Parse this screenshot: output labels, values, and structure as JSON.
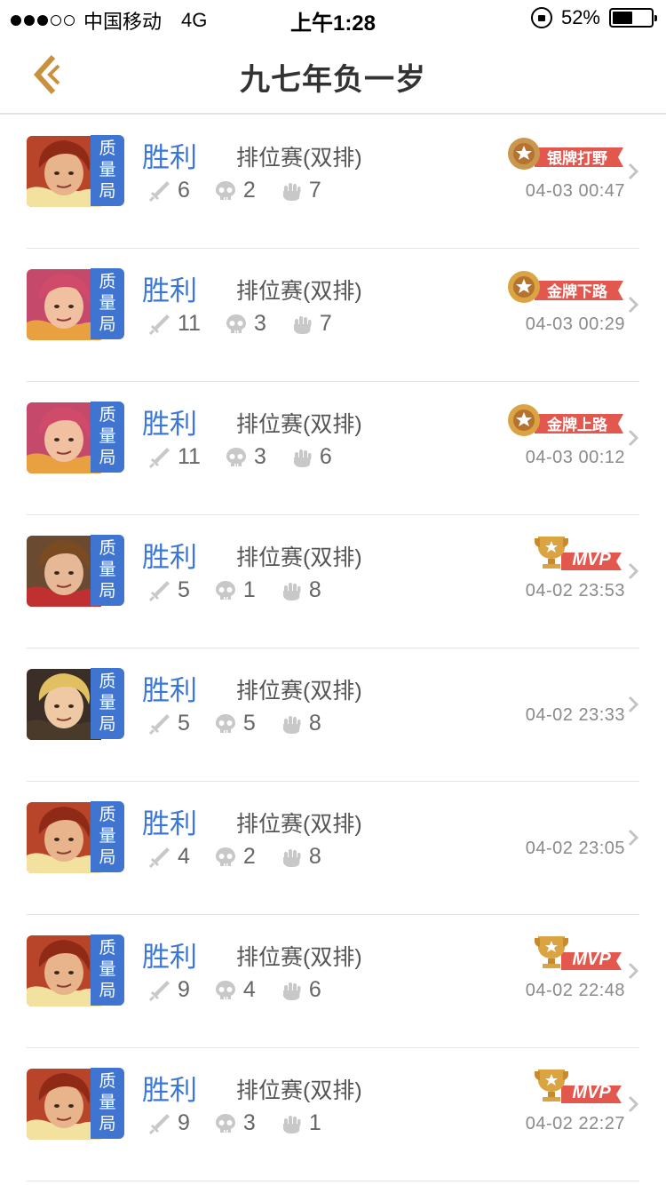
{
  "status_bar": {
    "carrier": "中国移动",
    "network": "4G",
    "time": "上午1:28",
    "battery_percent": "52%",
    "battery_level": 0.52,
    "signal_strength": 3
  },
  "nav": {
    "title": "九七年负一岁",
    "back_icon": "back-chevron-icon"
  },
  "colors": {
    "result_blue": "#3b77d6",
    "quality_tag_blue": "#3f74d0",
    "badge_red": "#e2584f",
    "gold": "#d9a441"
  },
  "matches": [
    {
      "quality_tag": "质量局",
      "result": "胜利",
      "mode": "排位赛(双排)",
      "kills": "6",
      "deaths": "2",
      "assists": "7",
      "badge": "银牌打野",
      "time": "04-03 00:47"
    },
    {
      "quality_tag": "质量局",
      "result": "胜利",
      "mode": "排位赛(双排)",
      "kills": "11",
      "deaths": "3",
      "assists": "7",
      "badge": "金牌下路",
      "time": "04-03 00:29"
    },
    {
      "quality_tag": "质量局",
      "result": "胜利",
      "mode": "排位赛(双排)",
      "kills": "11",
      "deaths": "3",
      "assists": "6",
      "badge": "金牌上路",
      "time": "04-03 00:12"
    },
    {
      "quality_tag": "质量局",
      "result": "胜利",
      "mode": "排位赛(双排)",
      "kills": "5",
      "deaths": "1",
      "assists": "8",
      "badge": "MVP",
      "time": "04-02 23:53"
    },
    {
      "quality_tag": "质量局",
      "result": "胜利",
      "mode": "排位赛(双排)",
      "kills": "5",
      "deaths": "5",
      "assists": "8",
      "badge": "",
      "time": "04-02 23:33"
    },
    {
      "quality_tag": "质量局",
      "result": "胜利",
      "mode": "排位赛(双排)",
      "kills": "4",
      "deaths": "2",
      "assists": "8",
      "badge": "",
      "time": "04-02 23:05"
    },
    {
      "quality_tag": "质量局",
      "result": "胜利",
      "mode": "排位赛(双排)",
      "kills": "9",
      "deaths": "4",
      "assists": "6",
      "badge": "MVP",
      "time": "04-02 22:48"
    },
    {
      "quality_tag": "质量局",
      "result": "胜利",
      "mode": "排位赛(双排)",
      "kills": "9",
      "deaths": "3",
      "assists": "1",
      "badge": "MVP",
      "time": "04-02 22:27"
    }
  ]
}
